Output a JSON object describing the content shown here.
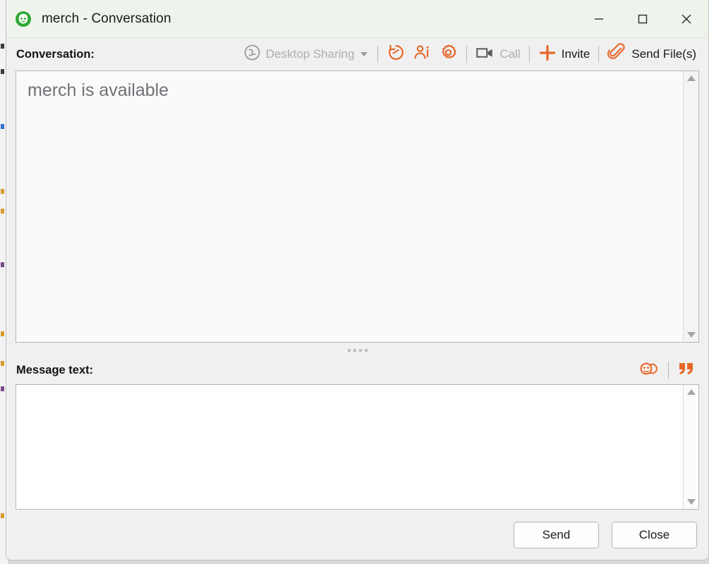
{
  "window": {
    "title": "merch - Conversation",
    "app_icon": "contact-avatar-icon",
    "titlebar_color": "#eef4ec",
    "accent_color": "#e8662a",
    "controls": {
      "minimize": "minimize-icon",
      "maximize": "maximize-icon",
      "close": "close-icon"
    }
  },
  "toolbar": {
    "conversation_label": "Conversation:",
    "items": [
      {
        "id": "desktop-sharing",
        "label": "Desktop Sharing",
        "icon": "desktop-sharing-icon",
        "enabled": false,
        "has_dropdown": true
      },
      {
        "id": "history",
        "label": "",
        "icon": "history-icon",
        "enabled": true
      },
      {
        "id": "contact-info",
        "label": "",
        "icon": "contact-info-icon",
        "enabled": true
      },
      {
        "id": "settings",
        "label": "",
        "icon": "gear-icon",
        "enabled": true
      },
      {
        "id": "call",
        "label": "Call",
        "icon": "video-camera-icon",
        "enabled": false
      },
      {
        "id": "invite",
        "label": "Invite",
        "icon": "plus-icon",
        "enabled": true
      },
      {
        "id": "send-files",
        "label": "Send File(s)",
        "icon": "paperclip-icon",
        "enabled": true
      }
    ]
  },
  "conversation": {
    "message": "merch is available",
    "scroll": {
      "up": "scroll-up-arrow",
      "down": "scroll-down-arrow"
    }
  },
  "message_area": {
    "label": "Message text:",
    "value": "",
    "tools": [
      {
        "id": "emoticon",
        "icon": "emoticon-icon"
      },
      {
        "id": "quote",
        "icon": "quote-icon"
      }
    ]
  },
  "footer": {
    "send_label": "Send",
    "close_label": "Close"
  }
}
